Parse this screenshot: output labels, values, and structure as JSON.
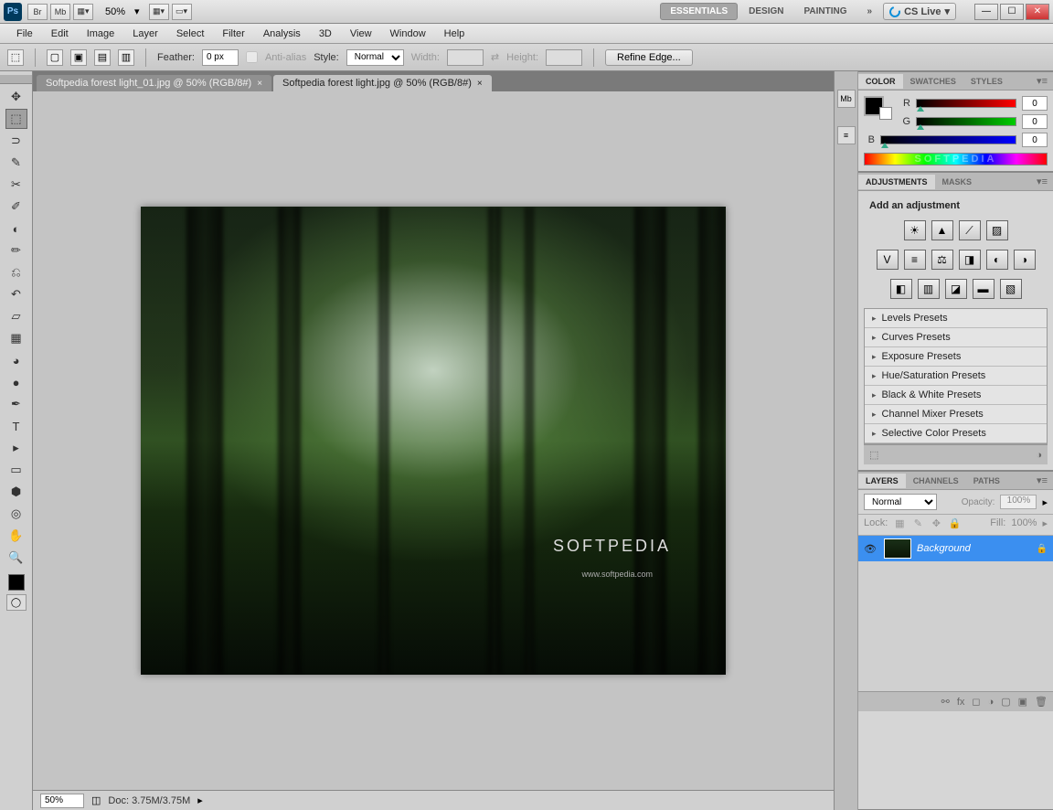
{
  "topbar": {
    "zoom": "50%",
    "workspaces": [
      "ESSENTIALS",
      "DESIGN",
      "PAINTING"
    ],
    "ws_active": 0,
    "cslive": "CS Live"
  },
  "menu": [
    "File",
    "Edit",
    "Image",
    "Layer",
    "Select",
    "Filter",
    "Analysis",
    "3D",
    "View",
    "Window",
    "Help"
  ],
  "options": {
    "feather_label": "Feather:",
    "feather_value": "0 px",
    "antialias_label": "Anti-alias",
    "style_label": "Style:",
    "style_value": "Normal",
    "width_label": "Width:",
    "height_label": "Height:",
    "refine": "Refine Edge..."
  },
  "doc_tabs": [
    {
      "title": "Softpedia forest light_01.jpg @ 50% (RGB/8#)"
    },
    {
      "title": "Softpedia forest light.jpg @ 50% (RGB/8#)"
    }
  ],
  "doc_active": 1,
  "canvas": {
    "watermark": "SOFTPEDIA",
    "url": "www.softpedia.com"
  },
  "color_panel": {
    "tabs": [
      "COLOR",
      "SWATCHES",
      "STYLES"
    ],
    "sliders": [
      {
        "label": "R",
        "value": "0"
      },
      {
        "label": "G",
        "value": "0"
      },
      {
        "label": "B",
        "value": "0"
      }
    ],
    "spectrum_text": "SOFTPEDIA"
  },
  "adjustments_panel": {
    "tabs": [
      "ADJUSTMENTS",
      "MASKS"
    ],
    "title": "Add an adjustment",
    "presets": [
      "Levels Presets",
      "Curves Presets",
      "Exposure Presets",
      "Hue/Saturation Presets",
      "Black & White Presets",
      "Channel Mixer Presets",
      "Selective Color Presets"
    ]
  },
  "layers_panel": {
    "tabs": [
      "LAYERS",
      "CHANNELS",
      "PATHS"
    ],
    "blend_mode": "Normal",
    "opacity_label": "Opacity:",
    "opacity_value": "100%",
    "lock_label": "Lock:",
    "fill_label": "Fill:",
    "fill_value": "100%",
    "layers": [
      {
        "name": "Background"
      }
    ]
  },
  "status": {
    "zoom": "50%",
    "doc_info": "Doc: 3.75M/3.75M"
  }
}
